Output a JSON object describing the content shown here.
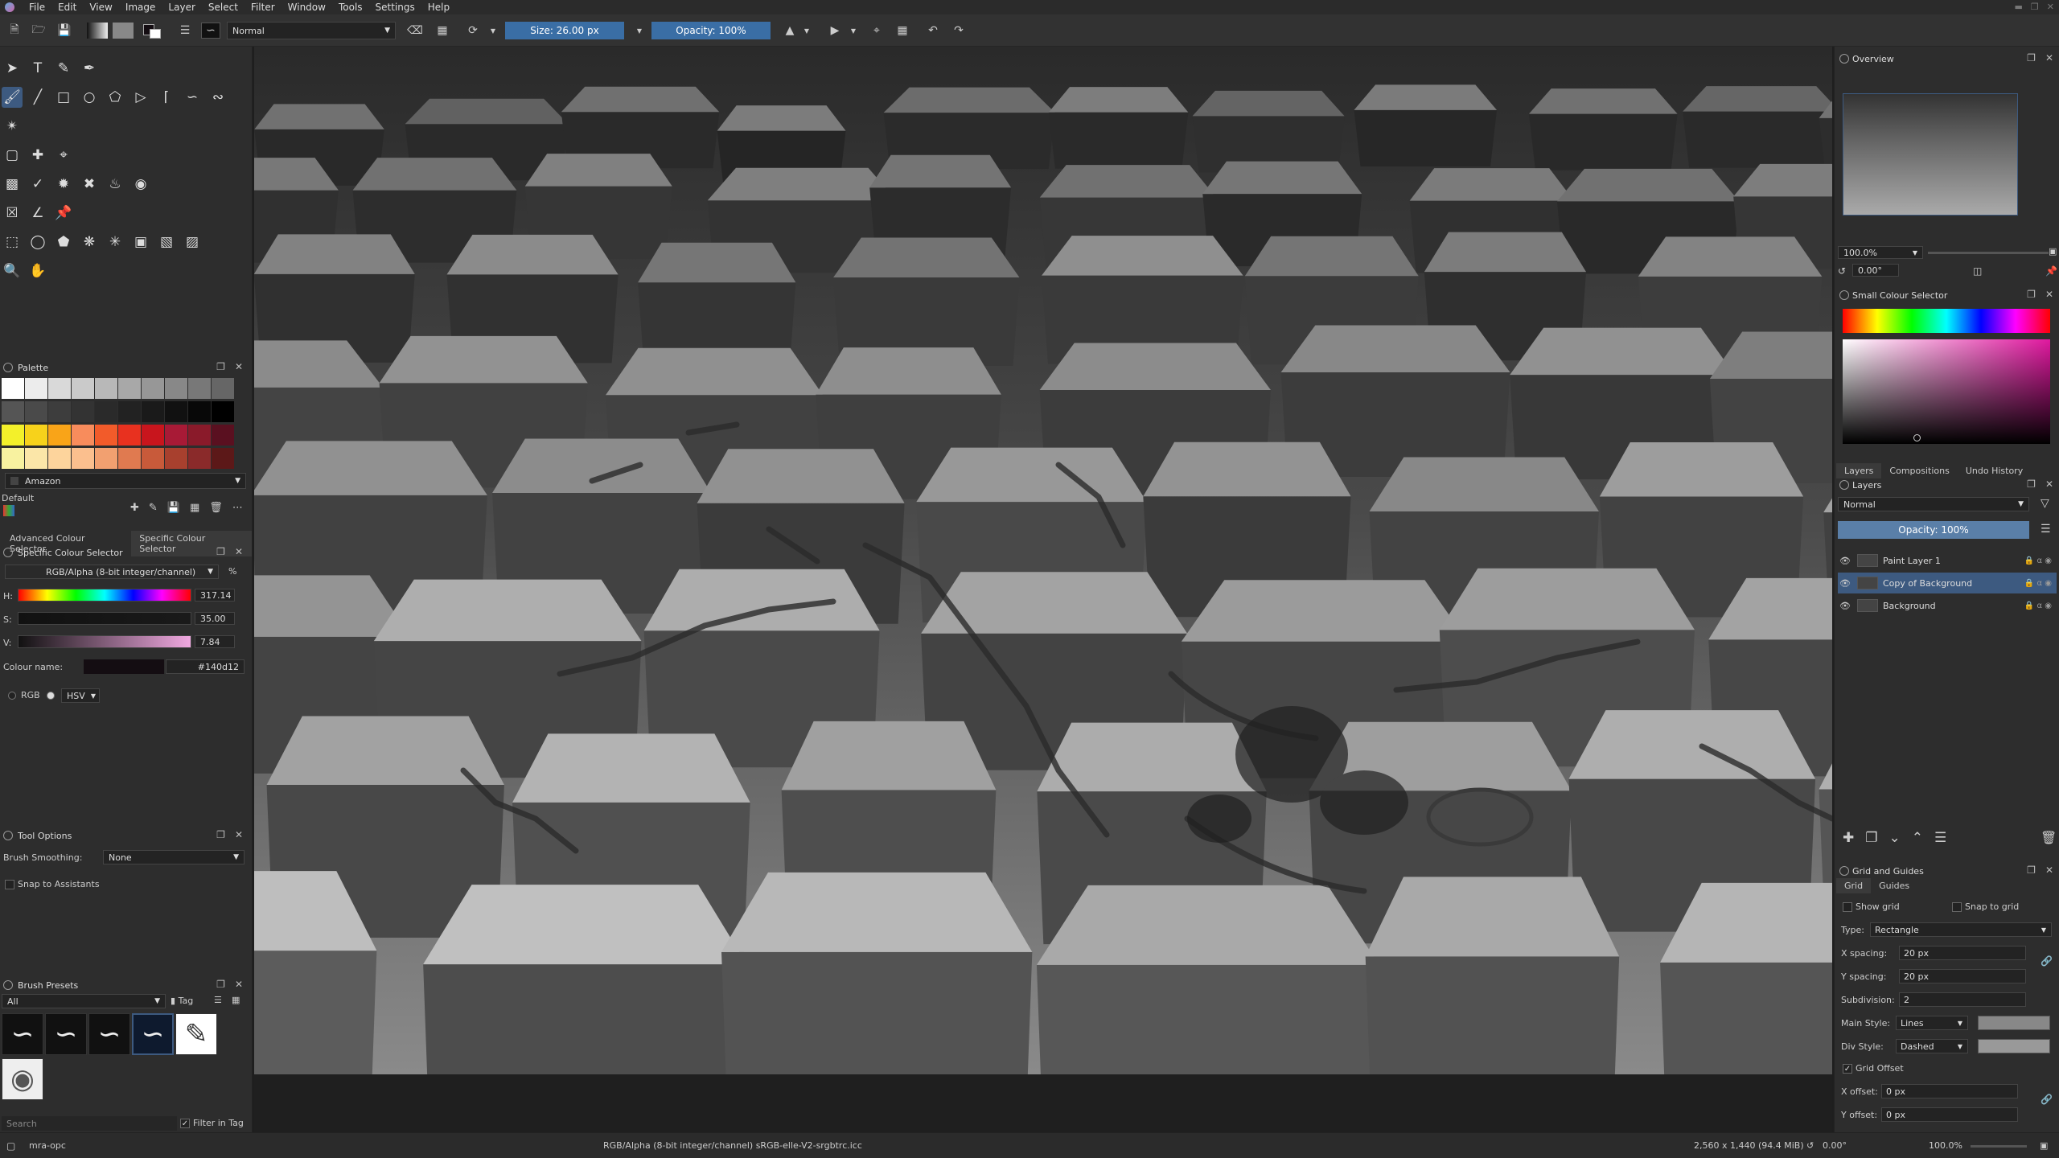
{
  "menubar": {
    "items": [
      "File",
      "Edit",
      "View",
      "Image",
      "Layer",
      "Select",
      "Filter",
      "Window",
      "Tools",
      "Settings",
      "Help"
    ]
  },
  "toolbar": {
    "blend_mode": "Normal",
    "size_label": "Size: 26.00 px",
    "opacity_label": "Opacity: 100%"
  },
  "palette": {
    "title": "Palette",
    "palette_name": "Amazon",
    "palette_set": "Default",
    "rows": [
      [
        "#ffffff",
        "#ececec",
        "#d9d9d9",
        "#cacaca",
        "#b8b8b8",
        "#a8a8a8",
        "#979797",
        "#888888",
        "#787878",
        "#666666"
      ],
      [
        "#555555",
        "#4a4a4a",
        "#3d3d3d",
        "#333333",
        "#2a2a2a",
        "#222222",
        "#1a1a1a",
        "#111111",
        "#080808",
        "#000000"
      ],
      [
        "#f3f02a",
        "#f7d21b",
        "#f9a418",
        "#f88c5c",
        "#f25b2a",
        "#e8311f",
        "#c8151d",
        "#a81a36",
        "#8a1a2a",
        "#5a1020"
      ],
      [
        "#f8f2a0",
        "#fbe6a8",
        "#fdd49c",
        "#fbbf8e",
        "#f2a070",
        "#e07a50",
        "#c85a3a",
        "#a8402e",
        "#8a2a2a",
        "#5c1818"
      ]
    ]
  },
  "colour_selectors": {
    "tab_advanced": "Advanced Colour Selector",
    "tab_specific": "Specific Colour Selector",
    "panel_title": "Specific Colour Selector",
    "colour_model": "RGB/Alpha (8-bit integer/channel)",
    "percent_symbol": "%",
    "h_label": "H:",
    "h_value": "317.14",
    "s_label": "S:",
    "s_value": "35.00",
    "v_label": "V:",
    "v_value": "7.84",
    "colour_name_label": "Colour name:",
    "colour_hex": "#140d12",
    "rgb_label": "RGB",
    "hsv_label": "HSV"
  },
  "tool_options": {
    "title": "Tool Options",
    "smoothing_label": "Brush Smoothing:",
    "smoothing_value": "None",
    "snap_label": "Snap to Assistants"
  },
  "brush_presets": {
    "title": "Brush Presets",
    "filter_value": "All",
    "tag_label": "Tag",
    "search_placeholder": "Search",
    "filter_in_tag": "Filter in Tag"
  },
  "overview": {
    "title": "Overview",
    "zoom": "100.0%",
    "rotation": "0.00°"
  },
  "small_colour_selector": {
    "title": "Small Colour Selector"
  },
  "right_tabs": [
    "Layers",
    "Compositions",
    "Undo History"
  ],
  "layers": {
    "title": "Layers",
    "blend_mode": "Normal",
    "opacity_label": "Opacity:  100%",
    "items": [
      {
        "name": "Paint Layer 1",
        "selected": false
      },
      {
        "name": "Copy of Background",
        "selected": true
      },
      {
        "name": "Background",
        "selected": false
      }
    ]
  },
  "grid_guides": {
    "title": "Grid and Guides",
    "tab_grid": "Grid",
    "tab_guides": "Guides",
    "show_grid": "Show grid",
    "snap_to_grid": "Snap to grid",
    "type_label": "Type:",
    "type_value": "Rectangle",
    "x_spacing_label": "X spacing:",
    "x_spacing_value": "20 px",
    "y_spacing_label": "Y spacing:",
    "y_spacing_value": "20 px",
    "subdivision_label": "Subdivision:",
    "subdivision_value": "2",
    "main_style_label": "Main Style:",
    "main_style_value": "Lines",
    "div_style_label": "Div Style:",
    "div_style_value": "Dashed",
    "grid_offset_label": "Grid Offset",
    "x_offset_label": "X offset:",
    "x_offset_value": "0 px",
    "y_offset_label": "Y offset:",
    "y_offset_value": "0 px"
  },
  "statusbar": {
    "brush_name": "mra-opc",
    "colour_info": "RGB/Alpha (8-bit integer/channel)  sRGB-elle-V2-srgbtrc.icc",
    "image_size": "2,560 x 1,440 (94.4 MiB)",
    "rotation": "0.00°",
    "zoom": "100.0%"
  },
  "colors": {
    "accent": "#3d5a80",
    "toolbar_blue": "#3a6ea5",
    "selected_colour": "#140d12"
  }
}
